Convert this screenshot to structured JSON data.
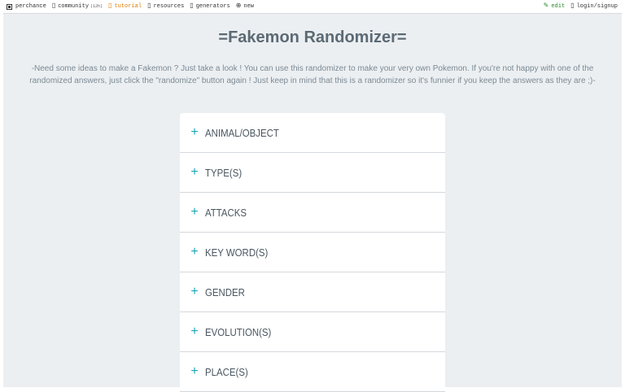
{
  "nav": {
    "brand": "perchance",
    "community": "community",
    "community_badge": "(12h)",
    "tutorial": "tutorial",
    "resources": "resources",
    "generators": "generators",
    "new": "new",
    "edit": "edit",
    "login": "login/signup",
    "icons": {
      "brand": "dice-icon",
      "community": "chat-icon",
      "tutorial": "book-icon",
      "resources": "folder-icon",
      "generators": "list-icon",
      "new": "plus-circle-icon",
      "edit": "pencil-icon",
      "login": "user-icon"
    }
  },
  "page": {
    "title": "=Fakemon Randomizer=",
    "description": "-Need some ideas to make a Fakemon ? Just take a look ! You can use this randomizer to make your very own Pokemon. If you're not happy with one of the randomized answers, just click the \"randomize\" button again ! Just keep in mind that this is a randomizer so it's funnier if you keep the answers as they are ;)-"
  },
  "accordion": {
    "items": [
      {
        "label": "ANIMAL/OBJECT"
      },
      {
        "label": "TYPE(S)"
      },
      {
        "label": "ATTACKS"
      },
      {
        "label": "KEY WORD(S)"
      },
      {
        "label": "GENDER"
      },
      {
        "label": "EVOLUTION(S)"
      },
      {
        "label": "PLACE(S)"
      }
    ],
    "expand_symbol": "+"
  },
  "colors": {
    "accent": "#1aa6b7",
    "background": "#eceff1",
    "title": "#5b6a75",
    "tutorial": "#e07b00",
    "edit": "#2a8a2a"
  }
}
